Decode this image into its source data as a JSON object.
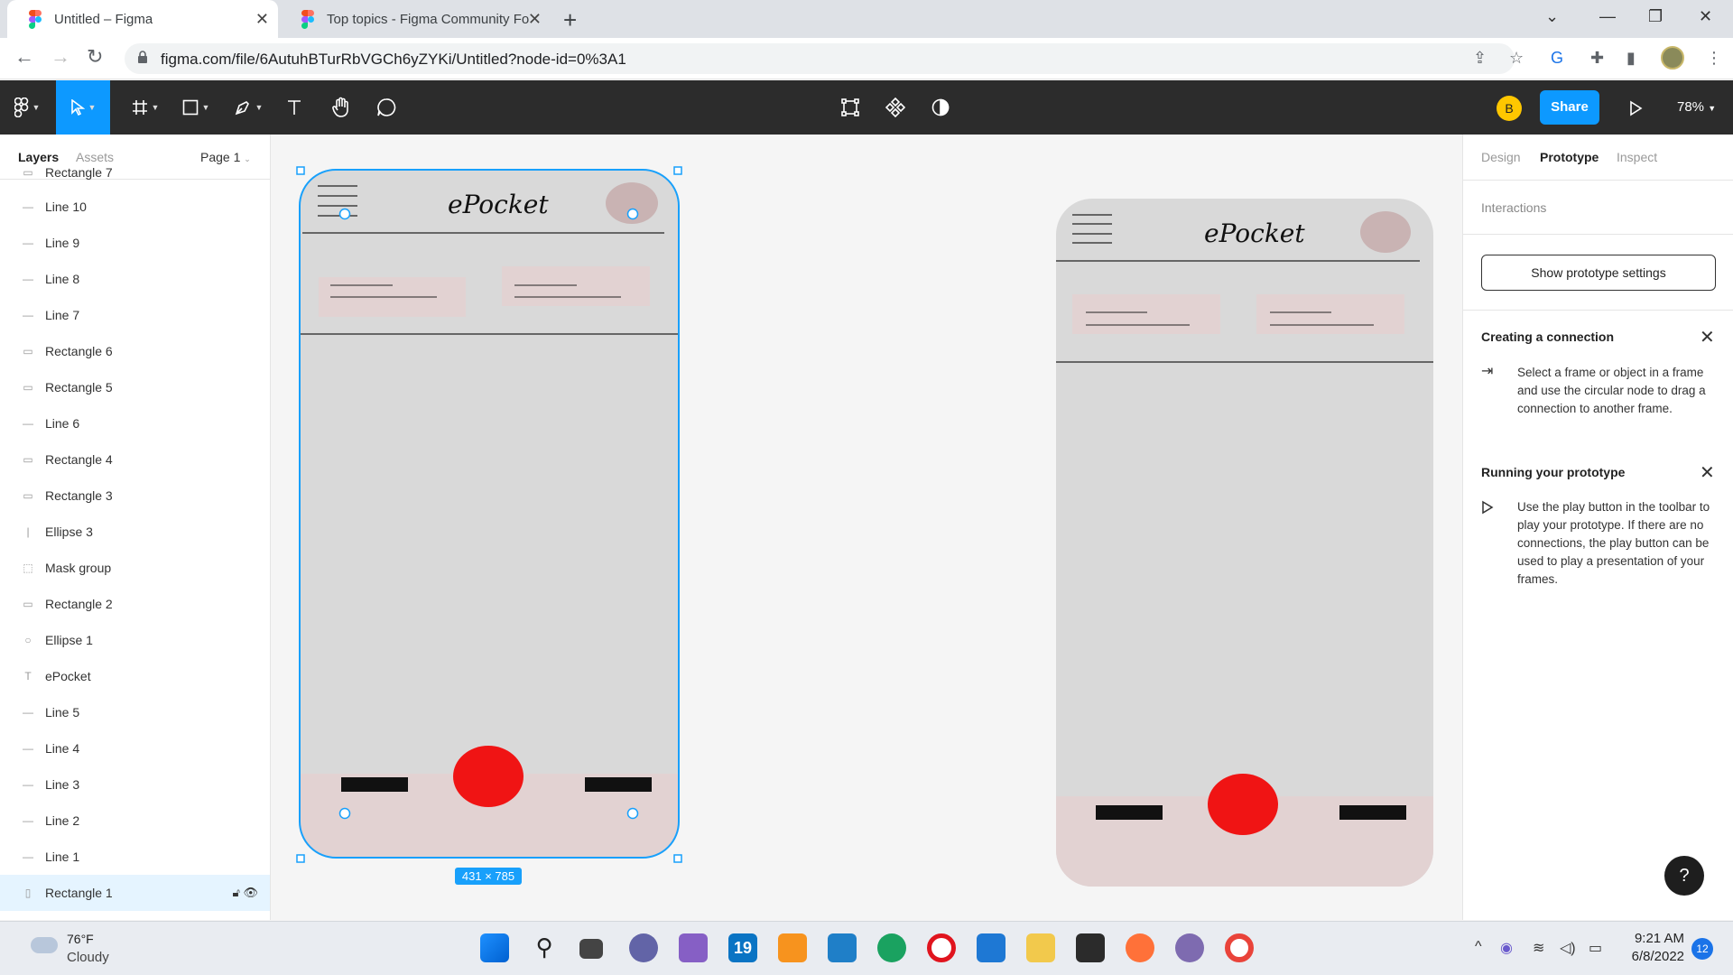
{
  "browser": {
    "tabs": [
      {
        "title": "Untitled – Figma",
        "active": true
      },
      {
        "title": "Top topics - Figma Community Fo",
        "active": false
      }
    ],
    "url": "figma.com/file/6AutuhBTurRbVGCh6yZYKi/Untitled?node-id=0%3A1"
  },
  "toolbar": {
    "user_initial": "B",
    "share_label": "Share",
    "zoom": "78%"
  },
  "left_panel": {
    "tabs": [
      "Layers",
      "Assets"
    ],
    "page": "Page 1",
    "layers": [
      {
        "name": "Rectangle 7",
        "icon": "rect"
      },
      {
        "name": "Line 10",
        "icon": "line"
      },
      {
        "name": "Line 9",
        "icon": "line"
      },
      {
        "name": "Line 8",
        "icon": "line"
      },
      {
        "name": "Line 7",
        "icon": "line"
      },
      {
        "name": "Rectangle 6",
        "icon": "rect"
      },
      {
        "name": "Rectangle 5",
        "icon": "rect"
      },
      {
        "name": "Line 6",
        "icon": "line"
      },
      {
        "name": "Rectangle 4",
        "icon": "rect"
      },
      {
        "name": "Rectangle 3",
        "icon": "rect"
      },
      {
        "name": "Ellipse 3",
        "icon": "vline"
      },
      {
        "name": "Mask group",
        "icon": "mask"
      },
      {
        "name": "Rectangle 2",
        "icon": "rect"
      },
      {
        "name": "Ellipse 1",
        "icon": "ellipse"
      },
      {
        "name": "ePocket",
        "icon": "text"
      },
      {
        "name": "Line 5",
        "icon": "line"
      },
      {
        "name": "Line 4",
        "icon": "line"
      },
      {
        "name": "Line 3",
        "icon": "line"
      },
      {
        "name": "Line 2",
        "icon": "line"
      },
      {
        "name": "Line 1",
        "icon": "line"
      },
      {
        "name": "Rectangle 1",
        "icon": "frame",
        "selected": true
      }
    ]
  },
  "canvas": {
    "frame_title": "ePocket",
    "size_badge": "431 × 785",
    "accent_red": "#f01414",
    "bottom_bar_color": "#e2d2d2",
    "frame_bg": "#d9d9d9"
  },
  "right_panel": {
    "tabs": [
      "Design",
      "Prototype",
      "Inspect"
    ],
    "interactions_label": "Interactions",
    "prototype_settings_btn": "Show prototype settings",
    "creating_title": "Creating a connection",
    "creating_text": "Select a frame or object in a frame and use the circular node to drag a connection to another frame.",
    "running_title": "Running your prototype",
    "running_text": "Use the play button in the toolbar to play your prototype. If there are no connections, the play button can be used to play a presentation of your frames.",
    "help": "?"
  },
  "taskbar": {
    "temp": "76°F",
    "weather": "Cloudy",
    "time": "9:21 AM",
    "date": "6/8/2022",
    "notifications": "12"
  }
}
